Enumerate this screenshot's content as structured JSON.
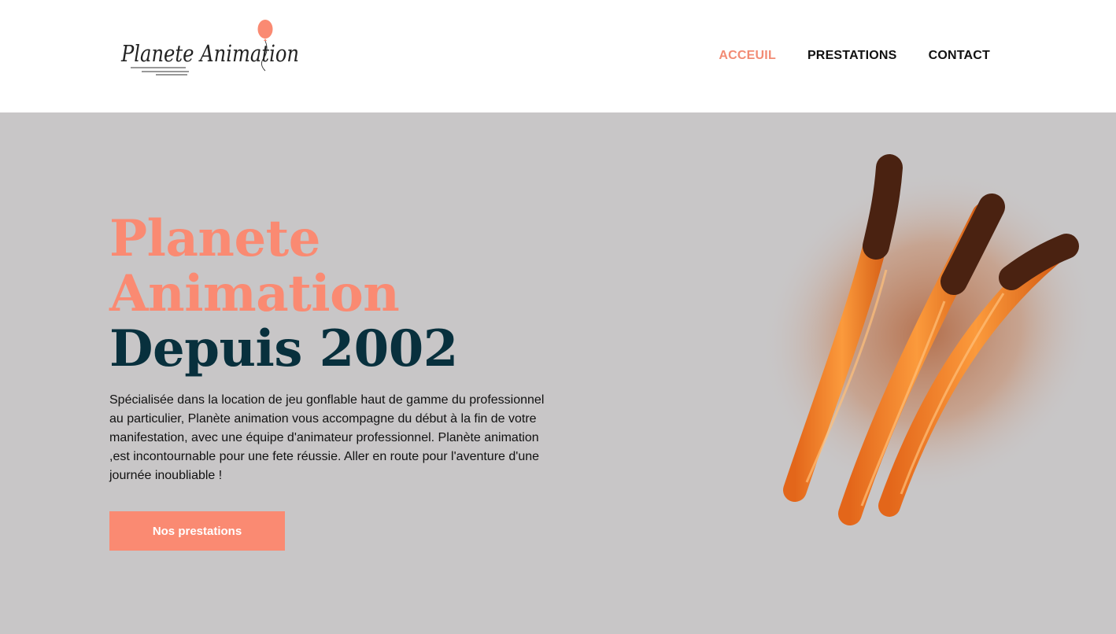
{
  "header": {
    "logo": {
      "text": "Planete Animation",
      "icon": "balloon-icon"
    },
    "nav": [
      {
        "label": "ACCEUIL",
        "active": true
      },
      {
        "label": "PRESTATIONS",
        "active": false
      },
      {
        "label": "CONTACT",
        "active": false
      }
    ]
  },
  "hero": {
    "title_line1": "Planete",
    "title_line2": "Animation",
    "title_line3": "Depuis 2002",
    "description": "Spécialisée dans la location de jeu gonflable haut de gamme du professionnel au particulier, Planète animation vous accompagne du début à la fin de votre manifestation, avec une équipe d'animateur professionnel. Planète animation ,est incontournable pour une fete réussie. Aller en route pour l'aventure d'une journée inoubliable !",
    "cta_label": "Nos prestations",
    "image": "churros-illustration"
  },
  "colors": {
    "accent": "#fa8a72",
    "dark": "#08303d",
    "background": "#c8c6c7",
    "header": "#ffffff"
  }
}
